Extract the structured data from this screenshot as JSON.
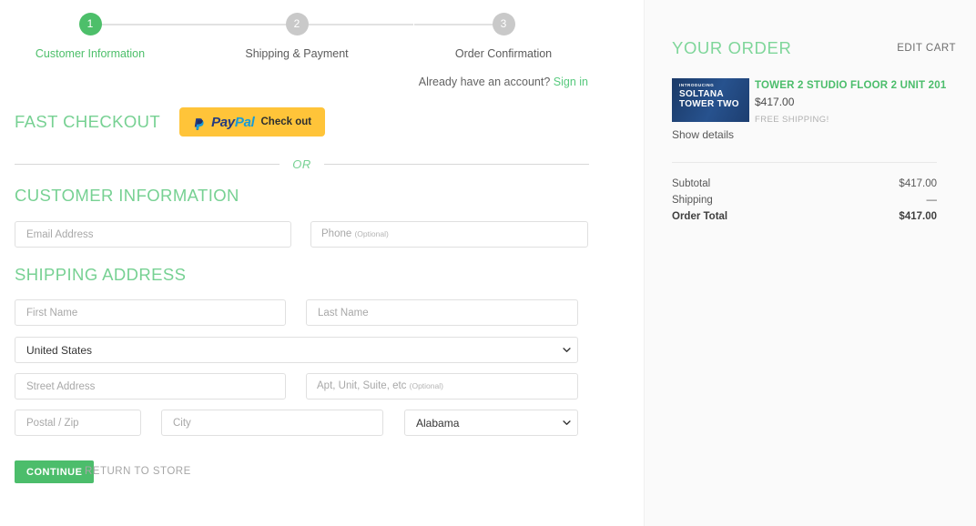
{
  "stepper": {
    "steps": [
      {
        "number": "1",
        "label": "Customer Information",
        "state": "active"
      },
      {
        "number": "2",
        "label": "Shipping & Payment",
        "state": "inactive"
      },
      {
        "number": "3",
        "label": "Order Confirmation",
        "state": "inactive"
      }
    ]
  },
  "account": {
    "prompt": "Already have an account?",
    "signin_label": "Sign in"
  },
  "fast_checkout": {
    "heading": "FAST CHECKOUT",
    "paypal": {
      "pay_text": "Pay",
      "pal_text": "Pal",
      "action_text": "Check out"
    }
  },
  "divider": {
    "text": "OR"
  },
  "customer_information": {
    "heading": "CUSTOMER INFORMATION",
    "email_placeholder": "Email Address",
    "phone_label": "Phone",
    "phone_optional": "(Optional)"
  },
  "shipping_address": {
    "heading": "SHIPPING ADDRESS",
    "first_name_placeholder": "First Name",
    "last_name_placeholder": "Last Name",
    "country_selected": "United States",
    "street_placeholder": "Street Address",
    "apt_label": "Apt, Unit, Suite, etc",
    "apt_optional": "(Optional)",
    "postal_placeholder": "Postal / Zip",
    "city_placeholder": "City",
    "state_selected": "Alabama"
  },
  "actions": {
    "continue_label": "CONTINUE",
    "return_label": "RETURN TO STORE"
  },
  "order_summary": {
    "title": "YOUR ORDER",
    "edit_cart_label": "EDIT CART",
    "product": {
      "thumbnail": {
        "line1": "INTRODUCING",
        "line2": "SOLTANA",
        "line3": "TOWER TWO"
      },
      "name": "TOWER 2 STUDIO FLOOR 2 UNIT 201",
      "price": "$417.00",
      "shipping_note": "FREE SHIPPING!"
    },
    "show_details_label": "Show details",
    "totals": [
      {
        "label": "Subtotal",
        "value": "$417.00",
        "emphasis": false
      },
      {
        "label": "Shipping",
        "value": "—",
        "emphasis": false
      },
      {
        "label": "Order Total",
        "value": "$417.00",
        "emphasis": true
      }
    ]
  },
  "colors": {
    "brand_green": "#4cbd6b",
    "heading_green": "#77d193",
    "paypal_yellow": "#ffc439",
    "paypal_dark_blue": "#253b80",
    "paypal_light_blue": "#179bd7",
    "sidebar_bg": "#fafafa",
    "thumbnail_navy": "#1f4172"
  }
}
